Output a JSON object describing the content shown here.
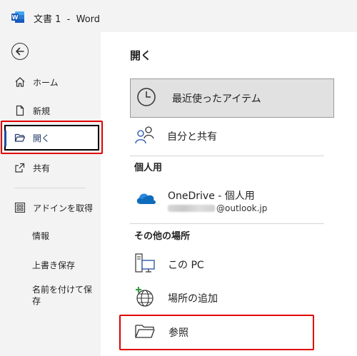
{
  "window": {
    "title": "文書 1  -  Word",
    "app_icon": "word-logo-icon"
  },
  "nav": {
    "back_icon": "back-arrow-icon",
    "items": [
      {
        "label": "ホーム",
        "icon": "home-icon"
      },
      {
        "label": "新規",
        "icon": "new-document-icon"
      },
      {
        "label": "開く",
        "icon": "open-folder-icon",
        "active": true
      },
      {
        "label": "共有",
        "icon": "share-icon"
      },
      {
        "label": "アドインを取得",
        "icon": "addins-grid-icon"
      },
      {
        "label": "情報"
      },
      {
        "label": "上書き保存"
      },
      {
        "label": "名前を付けて保存"
      }
    ]
  },
  "main": {
    "title": "開く",
    "recent": {
      "label": "最近使ったアイテム",
      "icon": "clock-icon"
    },
    "shared": {
      "label": "自分と共有",
      "icon": "people-icon"
    },
    "personal_header": "個人用",
    "onedrive": {
      "label": "OneDrive - 個人用",
      "email_suffix": "@outlook.jp",
      "icon": "onedrive-cloud-icon"
    },
    "other_header": "その他の場所",
    "this_pc": {
      "label": "この PC",
      "icon": "computer-icon"
    },
    "add_place": {
      "label": "場所の追加",
      "icon": "globe-add-icon"
    },
    "browse": {
      "label": "参照",
      "icon": "folder-icon"
    }
  },
  "colors": {
    "accent": "#1e4fa8",
    "highlight_border": "#e00000",
    "nav_background": "#f3f3f3",
    "selected_background": "#e1e1e1"
  }
}
